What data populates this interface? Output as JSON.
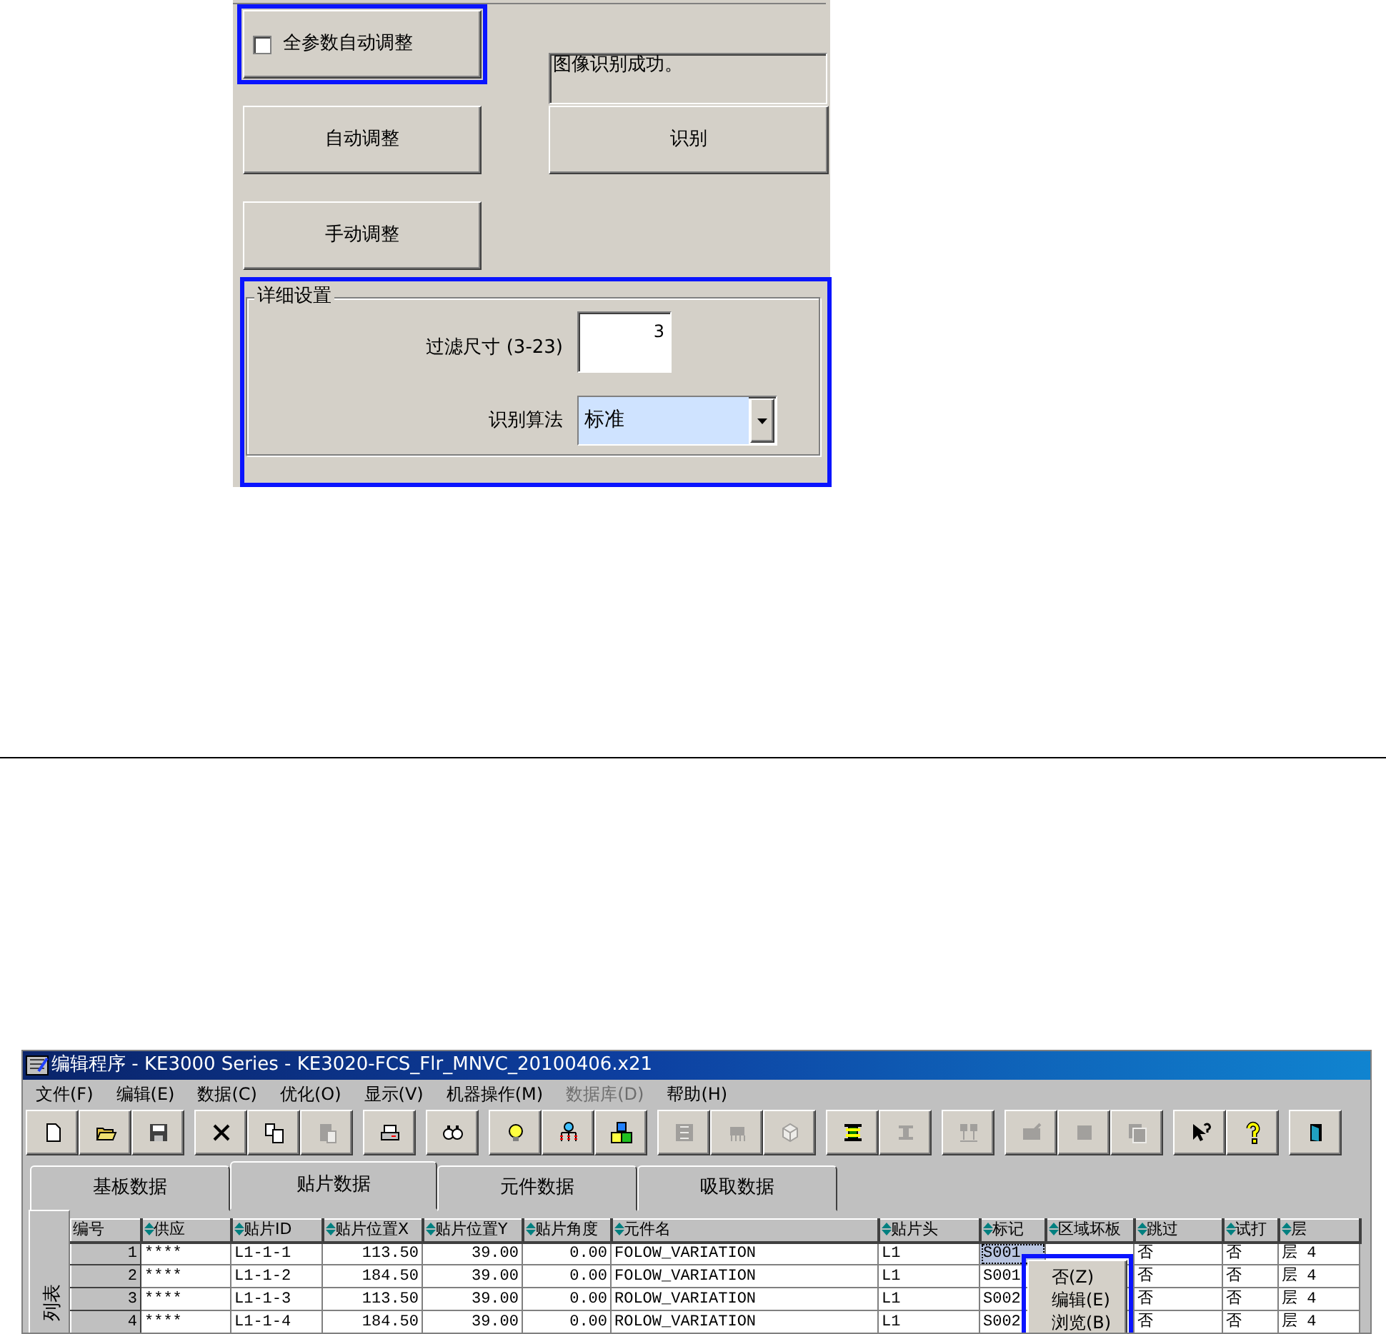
{
  "dialog": {
    "auto_all_params": {
      "label": "全参数自动调整",
      "checked": false,
      "highlighted": true
    },
    "status_text": "图像识别成功。",
    "buttons": [
      {
        "label": "自动调整"
      },
      {
        "label": "识别"
      },
      {
        "label": "手动调整"
      }
    ],
    "details": {
      "title": "详细设置",
      "highlighted": true,
      "filter_label": "过滤尺寸 (3-23)",
      "filter_value": "3",
      "algorithm_label": "识别算法",
      "algorithm_value": "标准"
    }
  },
  "window": {
    "title": "编辑程序 - KE3000 Series - KE3020-FCS_Flr_MNVC_20100406.x21",
    "menu": [
      {
        "label": "文件(F)",
        "disabled": false
      },
      {
        "label": "编辑(E)",
        "disabled": false
      },
      {
        "label": "数据(C)",
        "disabled": false
      },
      {
        "label": "优化(O)",
        "disabled": false
      },
      {
        "label": "显示(V)",
        "disabled": false
      },
      {
        "label": "机器操作(M)",
        "disabled": false
      },
      {
        "label": "数据库(D)",
        "disabled": true
      },
      {
        "label": "帮助(H)",
        "disabled": false
      }
    ],
    "toolbar": [
      [
        {
          "kind": "new",
          "disabled": false
        },
        {
          "kind": "open",
          "disabled": false
        },
        {
          "kind": "save",
          "disabled": false
        }
      ],
      [
        {
          "kind": "delete",
          "disabled": false
        },
        {
          "kind": "copy",
          "disabled": false
        },
        {
          "kind": "paste",
          "disabled": true
        }
      ],
      [
        {
          "kind": "print",
          "disabled": false
        }
      ],
      [
        {
          "kind": "find",
          "disabled": false
        }
      ],
      [
        {
          "kind": "bulb",
          "disabled": false
        },
        {
          "kind": "tree",
          "disabled": false
        },
        {
          "kind": "blocks",
          "disabled": false
        }
      ],
      [
        {
          "kind": "grid",
          "disabled": true
        },
        {
          "kind": "chip",
          "disabled": true
        },
        {
          "kind": "cube",
          "disabled": true
        }
      ],
      [
        {
          "kind": "swap",
          "disabled": false
        },
        {
          "kind": "ibeam",
          "disabled": true
        }
      ],
      [
        {
          "kind": "nozzles",
          "disabled": true
        }
      ],
      [
        {
          "kind": "board",
          "disabled": true
        },
        {
          "kind": "square",
          "disabled": true
        },
        {
          "kind": "pages",
          "disabled": true
        }
      ],
      [
        {
          "kind": "helpcursor",
          "disabled": false
        },
        {
          "kind": "question",
          "disabled": false
        }
      ],
      [
        {
          "kind": "door",
          "disabled": false
        }
      ]
    ],
    "tabs": [
      {
        "label": "基板数据",
        "selected": false
      },
      {
        "label": "贴片数据",
        "selected": true
      },
      {
        "label": "元件数据",
        "selected": false
      },
      {
        "label": "吸取数据",
        "selected": false
      }
    ],
    "side_label": "列表",
    "table": {
      "columns": [
        {
          "label": "编号",
          "sortable": false
        },
        {
          "label": "供应",
          "sortable": true
        },
        {
          "label": "贴片ID",
          "sortable": true
        },
        {
          "label": "贴片位置X",
          "sortable": true
        },
        {
          "label": "贴片位置Y",
          "sortable": true
        },
        {
          "label": "贴片角度",
          "sortable": true
        },
        {
          "label": "元件名",
          "sortable": true
        },
        {
          "label": "贴片头",
          "sortable": true
        },
        {
          "label": "标记",
          "sortable": true
        },
        {
          "label": "区域坏板",
          "sortable": true
        },
        {
          "label": "跳过",
          "sortable": true
        },
        {
          "label": "试打",
          "sortable": true
        },
        {
          "label": "层",
          "sortable": true
        }
      ],
      "rows": [
        {
          "cells": [
            "1",
            "****",
            "L1-1-1",
            "113.50",
            "39.00",
            "0.00",
            "FOLOW_VARIATION",
            "L1",
            "S001",
            null,
            "否",
            "否",
            "层 4"
          ],
          "selected": true
        },
        {
          "cells": [
            "2",
            "****",
            "L1-1-2",
            "184.50",
            "39.00",
            "0.00",
            "FOLOW_VARIATION",
            "L1",
            "S001",
            null,
            "否",
            "否",
            "层 4"
          ],
          "selected": false
        },
        {
          "cells": [
            "3",
            "****",
            "L1-1-3",
            "113.50",
            "39.00",
            "0.00",
            "ROLOW_VARIATION",
            "L1",
            "S002",
            null,
            "否",
            "否",
            "层 4"
          ],
          "selected": false
        },
        {
          "cells": [
            "4",
            "****",
            "L1-1-4",
            "184.50",
            "39.00",
            "0.00",
            "ROLOW_VARIATION",
            "L1",
            "S002",
            null,
            "否",
            "否",
            "层 4"
          ],
          "selected": false
        }
      ]
    },
    "context_menu": {
      "highlighted": true,
      "items": [
        "否(Z)",
        "编辑(E)",
        "浏览(B)"
      ]
    }
  }
}
